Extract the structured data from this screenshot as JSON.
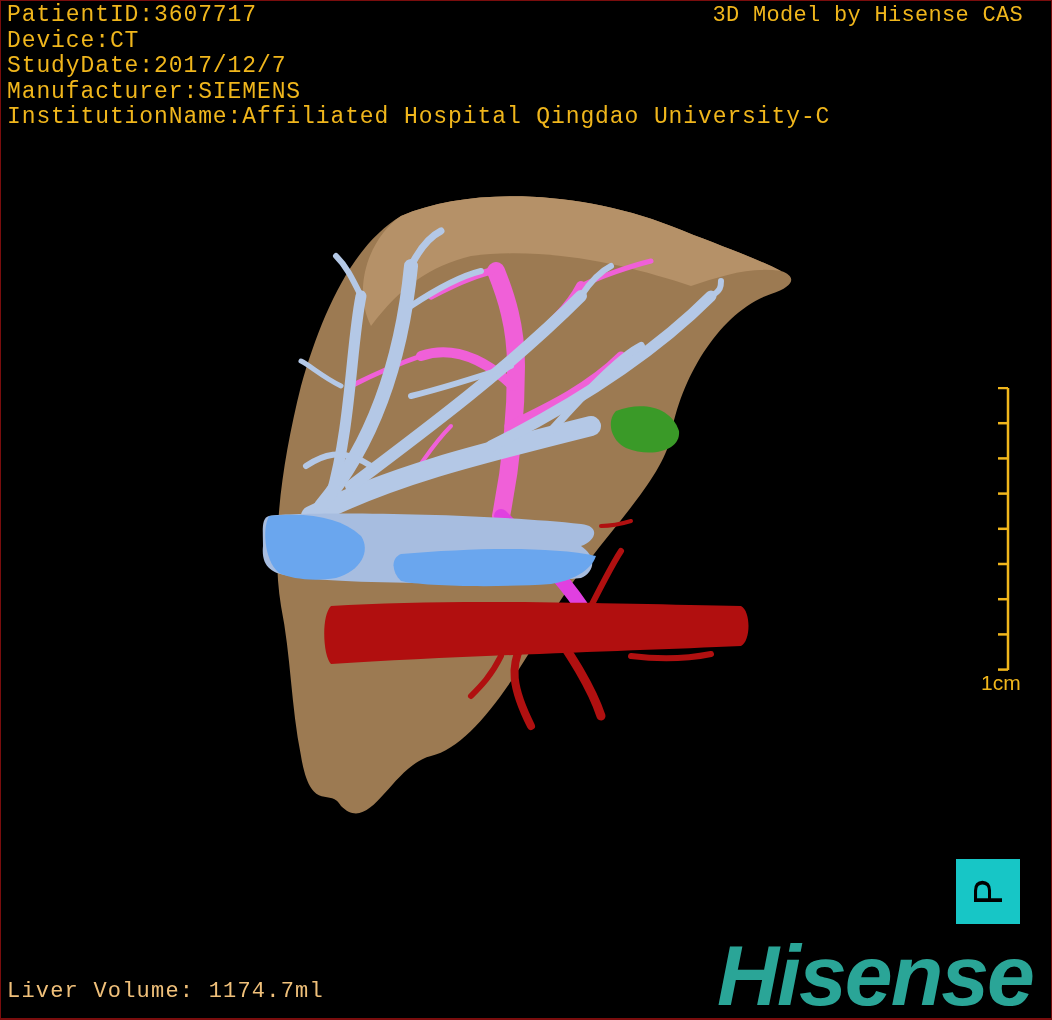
{
  "study_info": [
    "PatientID:3607717",
    "Device:CT",
    "StudyDate:2017/12/7",
    "Manufacturer:SIEMENS",
    "InstitutionName:Affiliated Hospital Qingdao University-C"
  ],
  "model_credit": "3D Model by Hisense CAS",
  "scale_bar": {
    "label": "1cm"
  },
  "orientation_cube": {
    "label": "P"
  },
  "logo": "Hisense",
  "liver_volume": "Liver Volume: 1174.7ml"
}
